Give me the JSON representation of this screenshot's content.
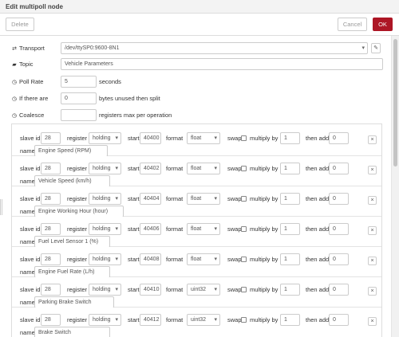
{
  "dialog": {
    "title": "Edit multipoll node"
  },
  "toolbar": {
    "delete_label": "Delete",
    "cancel_label": "Cancel",
    "ok_label": "OK"
  },
  "form": {
    "transport": {
      "label": "Transport",
      "value": "/dev/ttySP0:9600-8N1",
      "edit_icon": "pencil-icon"
    },
    "topic": {
      "label": "Topic",
      "value": "Vehicle Parameters"
    },
    "poll_rate": {
      "label": "Poll Rate",
      "value": "5",
      "unit": "seconds"
    },
    "if_there_are": {
      "label": "If there are",
      "value": "0",
      "suffix": "bytes unused then split"
    },
    "coalesce": {
      "label": "Coalesce",
      "value": "",
      "suffix": "registers max per operation"
    }
  },
  "row_labels": {
    "slave_id": "slave id",
    "register": "register",
    "start": "start",
    "format": "format",
    "swap": "swap",
    "multiply_by": "multiply by",
    "then_add": "then add",
    "name": "name",
    "remove": "×"
  },
  "rows": [
    {
      "slave_id": "28",
      "register": "holding",
      "start": "40400",
      "format": "float",
      "multiply": "1",
      "add": "0",
      "name": "Engine Speed (RPM)"
    },
    {
      "slave_id": "28",
      "register": "holding",
      "start": "40402",
      "format": "float",
      "multiply": "1",
      "add": "0",
      "name": "Vehicle Speed (km/h)"
    },
    {
      "slave_id": "28",
      "register": "holding",
      "start": "40404",
      "format": "float",
      "multiply": "1",
      "add": "0",
      "name": "Engine Working Hour (hour)"
    },
    {
      "slave_id": "28",
      "register": "holding",
      "start": "40406",
      "format": "float",
      "multiply": "1",
      "add": "0",
      "name": "Fuel Level Sensor 1 (%)"
    },
    {
      "slave_id": "28",
      "register": "holding",
      "start": "40408",
      "format": "float",
      "multiply": "1",
      "add": "0",
      "name": "Engine Fuel Rate (L/h)"
    },
    {
      "slave_id": "28",
      "register": "holding",
      "start": "40410",
      "format": "uint32",
      "multiply": "1",
      "add": "0",
      "name": "Parking Brake Switch"
    },
    {
      "slave_id": "28",
      "register": "holding",
      "start": "40412",
      "format": "uint32",
      "multiply": "1",
      "add": "0",
      "name": "Brake Switch"
    }
  ],
  "colors": {
    "ok_button": "#ad1625",
    "border": "#cccccc"
  }
}
